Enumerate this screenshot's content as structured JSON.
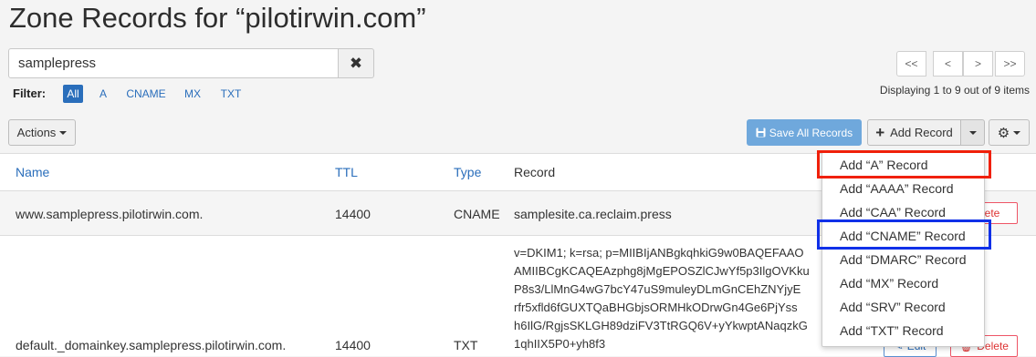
{
  "page": {
    "title": "Zone Records for “pilotirwin.com”"
  },
  "search": {
    "value": "samplepress",
    "clear_icon": "✖"
  },
  "filter": {
    "label": "Filter:",
    "options": [
      "All",
      "A",
      "CNAME",
      "MX",
      "TXT"
    ],
    "active": "All"
  },
  "pagination": {
    "first": "<<",
    "prev": "<",
    "next": ">",
    "last": ">>",
    "info": "Displaying 1 to 9 out of 9 items"
  },
  "toolbar": {
    "actions_label": "Actions",
    "save_all_label": "Save All Records",
    "add_record_label": "Add Record",
    "add_icon": "+",
    "settings_icon": "⚙"
  },
  "table": {
    "headers": {
      "name": "Name",
      "ttl": "TTL",
      "type": "Type",
      "record": "Record"
    },
    "rows": [
      {
        "name": "www.samplepress.pilotirwin.com.",
        "ttl": "14400",
        "type": "CNAME",
        "record": "samplesite.ca.reclaim.press",
        "delete_label": "Delete"
      },
      {
        "name": "default._domainkey.samplepress.pilotirwin.com.",
        "ttl": "14400",
        "type": "TXT",
        "record_lines": [
          "v=DKIM1; k=rsa; p=MIIBIjANBgkqhkiG9w0BAQEFAAO",
          "AMIIBCgKCAQEAzphg8jMgEPOSZlCJwYf5p3IlgOVKku",
          "P8s3/LlMnG4wG7bcY47uS9muleyDLmGnCEhZNYjyE",
          "rfr5xfld6fGUXTQaBHGbjsORMHkODrwGn4Ge6PjYss",
          "h6IlG/RgjsSKLGH89dziFV3TtRGQ6V+yYkwptANaqzkG",
          "1qhIIX5P0+yh8f3"
        ],
        "edit_label": "Edit",
        "delete_label": "Delete"
      }
    ]
  },
  "add_record_menu": {
    "items": [
      "Add “A” Record",
      "Add “AAAA” Record",
      "Add “CAA” Record",
      "Add “CNAME” Record",
      "Add “DMARC” Record",
      "Add “MX” Record",
      "Add “SRV” Record",
      "Add “TXT” Record"
    ]
  },
  "colors": {
    "accent": "#2a6ebb",
    "save_button": "#6fa8dc",
    "highlight_red": "#f0200a",
    "highlight_blue": "#1030e8"
  }
}
